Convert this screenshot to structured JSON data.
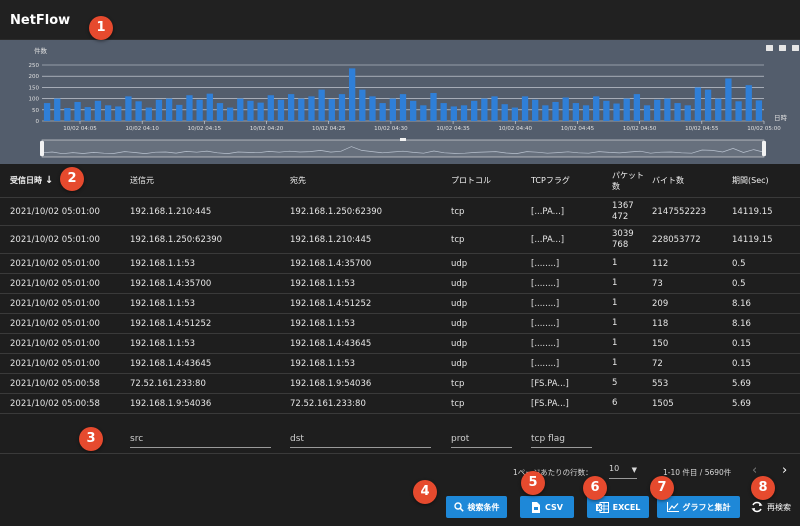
{
  "app": {
    "title": "NetFlow"
  },
  "markers": [
    "1",
    "2",
    "3",
    "4",
    "5",
    "6",
    "7",
    "8"
  ],
  "chart_data": {
    "type": "bar",
    "ylabel": "件数",
    "xlabel": "日時",
    "ylim": [
      0,
      250
    ],
    "yticks": [
      "0",
      "50",
      "100",
      "150",
      "200",
      "250"
    ],
    "xticks": [
      "10/02 04:05",
      "10/02 04:10",
      "10/02 04:15",
      "10/02 04:20",
      "10/02 04:25",
      "10/02 04:30",
      "10/02 04:35",
      "10/02 04:40",
      "10/02 04:45",
      "10/02 04:50",
      "10/02 04:55",
      "10/02 05:00"
    ],
    "grid": true,
    "color": "#2f7fd8",
    "values": [
      80,
      100,
      58,
      85,
      62,
      90,
      70,
      65,
      110,
      88,
      60,
      95,
      100,
      72,
      115,
      95,
      122,
      80,
      60,
      100,
      90,
      82,
      115,
      95,
      120,
      100,
      110,
      140,
      98,
      120,
      235,
      140,
      110,
      80,
      100,
      120,
      90,
      70,
      125,
      80,
      65,
      70,
      90,
      100,
      110,
      75,
      60,
      110,
      95,
      70,
      85,
      105,
      80,
      70,
      110,
      90,
      78,
      100,
      120,
      70,
      95,
      100,
      80,
      70,
      150,
      140,
      100,
      190,
      88,
      160,
      92
    ],
    "toolbox_icons": [
      "data-view-icon",
      "bar-type-icon",
      "line-type-icon"
    ]
  },
  "table": {
    "columns": [
      {
        "key": "time",
        "label": "受信日時",
        "sorted": true
      },
      {
        "key": "src",
        "label": "送信元"
      },
      {
        "key": "dst",
        "label": "宛先"
      },
      {
        "key": "prot",
        "label": "プロトコル"
      },
      {
        "key": "flag",
        "label": "TCPフラグ"
      },
      {
        "key": "pkts",
        "label": "パケット数"
      },
      {
        "key": "bytes",
        "label": "バイト数"
      },
      {
        "key": "dur",
        "label": "期間(Sec)"
      }
    ],
    "rows": [
      {
        "time": "2021/10/02 05:01:00",
        "src": "192.168.1.210:445",
        "dst": "192.168.1.250:62390",
        "prot": "tcp",
        "flag": "[...PA...]",
        "pkts": "1367\n472",
        "bytes": "2147552223",
        "dur": "14119.15"
      },
      {
        "time": "2021/10/02 05:01:00",
        "src": "192.168.1.250:62390",
        "dst": "192.168.1.210:445",
        "prot": "tcp",
        "flag": "[...PA...]",
        "pkts": "3039\n768",
        "bytes": "228053772",
        "dur": "14119.15"
      },
      {
        "time": "2021/10/02 05:01:00",
        "src": "192.168.1.1:53",
        "dst": "192.168.1.4:35700",
        "prot": "udp",
        "flag": "[........]",
        "pkts": "1",
        "bytes": "112",
        "dur": "0.5"
      },
      {
        "time": "2021/10/02 05:01:00",
        "src": "192.168.1.4:35700",
        "dst": "192.168.1.1:53",
        "prot": "udp",
        "flag": "[........]",
        "pkts": "1",
        "bytes": "73",
        "dur": "0.5"
      },
      {
        "time": "2021/10/02 05:01:00",
        "src": "192.168.1.1:53",
        "dst": "192.168.1.4:51252",
        "prot": "udp",
        "flag": "[........]",
        "pkts": "1",
        "bytes": "209",
        "dur": "8.16"
      },
      {
        "time": "2021/10/02 05:01:00",
        "src": "192.168.1.4:51252",
        "dst": "192.168.1.1:53",
        "prot": "udp",
        "flag": "[........]",
        "pkts": "1",
        "bytes": "118",
        "dur": "8.16"
      },
      {
        "time": "2021/10/02 05:01:00",
        "src": "192.168.1.1:53",
        "dst": "192.168.1.4:43645",
        "prot": "udp",
        "flag": "[........]",
        "pkts": "1",
        "bytes": "150",
        "dur": "0.15"
      },
      {
        "time": "2021/10/02 05:01:00",
        "src": "192.168.1.4:43645",
        "dst": "192.168.1.1:53",
        "prot": "udp",
        "flag": "[........]",
        "pkts": "1",
        "bytes": "72",
        "dur": "0.15"
      },
      {
        "time": "2021/10/02 05:00:58",
        "src": "72.52.161.233:80",
        "dst": "192.168.1.9:54036",
        "prot": "tcp",
        "flag": "[FS.PA...]",
        "pkts": "5",
        "bytes": "553",
        "dur": "5.69"
      },
      {
        "time": "2021/10/02 05:00:58",
        "src": "192.168.1.9:54036",
        "dst": "72.52.161.233:80",
        "prot": "tcp",
        "flag": "[FS.PA...]",
        "pkts": "6",
        "bytes": "1505",
        "dur": "5.69"
      }
    ]
  },
  "filters": {
    "src_placeholder": "src",
    "dst_placeholder": "dst",
    "prot_placeholder": "prot",
    "flag_placeholder": "tcp flag"
  },
  "pager": {
    "rows_per_page_label": "1ページあたりの行数：",
    "rows_per_page": "10",
    "range": "1-10 件目 / 5690件"
  },
  "actions": {
    "search": "検索条件",
    "csv": "CSV",
    "excel": "EXCEL",
    "graph": "グラフと集計",
    "reload": "再検索"
  }
}
